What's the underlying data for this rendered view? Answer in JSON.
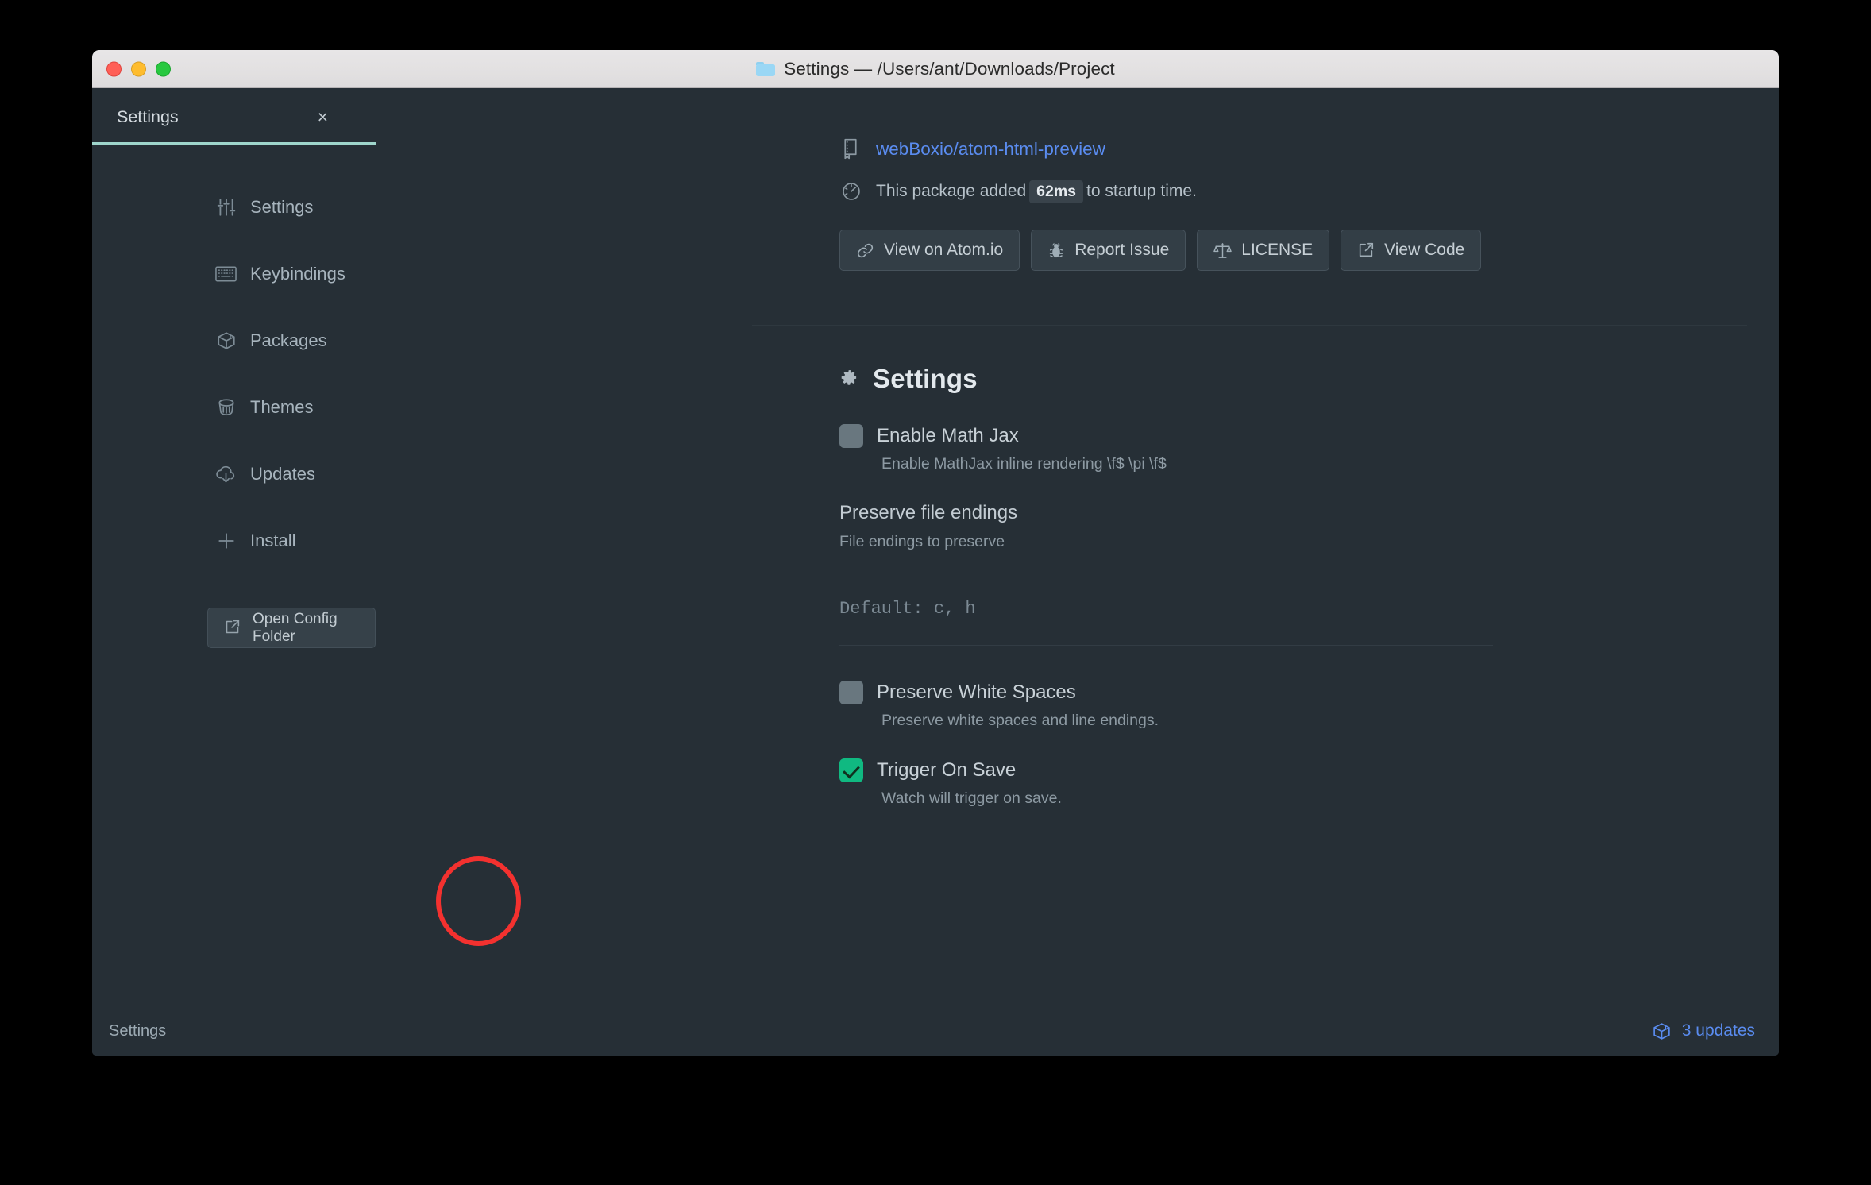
{
  "window": {
    "title": "Settings — /Users/ant/Downloads/Project",
    "title_icon": "folder-icon",
    "traffic_lights": [
      "close-red",
      "minimize-yellow",
      "zoom-green"
    ]
  },
  "tabbar": {
    "tab_label": "Settings",
    "close_glyph": "×",
    "active_underline_color": "#9fd6cc"
  },
  "sidebar": {
    "items": [
      {
        "label": "Settings",
        "icon": "sliders-icon"
      },
      {
        "label": "Keybindings",
        "icon": "keyboard-icon"
      },
      {
        "label": "Packages",
        "icon": "package-icon"
      },
      {
        "label": "Themes",
        "icon": "paintbucket-icon"
      },
      {
        "label": "Updates",
        "icon": "cloud-download-icon"
      },
      {
        "label": "Install",
        "icon": "plus-icon"
      }
    ],
    "config_button": {
      "label": "Open Config Folder",
      "icon": "external-link-icon"
    }
  },
  "package": {
    "link_text": "webBoxio/atom-html-preview",
    "link_icon": "book-icon",
    "link_color": "#5a8cf0",
    "startup_icon": "gauge-icon",
    "startup_prefix": "This package added",
    "startup_value": "62ms",
    "startup_suffix": "to startup time.",
    "buttons": [
      {
        "label": "View on Atom.io",
        "icon": "link-icon"
      },
      {
        "label": "Report Issue",
        "icon": "bug-icon"
      },
      {
        "label": "LICENSE",
        "icon": "law-scales-icon"
      },
      {
        "label": "View Code",
        "icon": "external-link-icon"
      }
    ]
  },
  "settings": {
    "heading": "Settings",
    "heading_icon": "gear-icon",
    "mathjax": {
      "title": "Enable Math Jax",
      "description": "Enable MathJax inline rendering \\f$ \\pi \\f$",
      "checked": false
    },
    "file_endings": {
      "title": "Preserve file endings",
      "description": "File endings to preserve",
      "default_text": "Default: c, h",
      "value": ""
    },
    "white_spaces": {
      "title": "Preserve White Spaces",
      "description": "Preserve white spaces and line endings.",
      "checked": false
    },
    "trigger_on_save": {
      "title": "Trigger On Save",
      "description": "Watch will trigger on save.",
      "checked": true,
      "checked_color": "#10b981",
      "annotation_color": "#f3312f"
    }
  },
  "statusbar": {
    "left_label": "Settings",
    "updates_label": "3 updates",
    "updates_icon": "package-icon",
    "updates_color": "#5a8cf0"
  }
}
